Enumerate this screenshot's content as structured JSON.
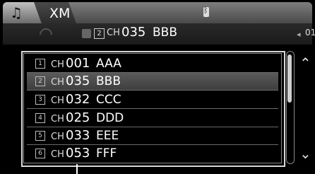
{
  "tabs": {
    "xm_label": "XM"
  },
  "now_playing": {
    "preset": "2",
    "ch_prefix": "CH",
    "channel": "035",
    "name": "BBB",
    "volume": "01"
  },
  "channels": [
    {
      "preset": "1",
      "ch_prefix": "CH",
      "number": "001",
      "name": "AAA",
      "selected": false
    },
    {
      "preset": "2",
      "ch_prefix": "CH",
      "number": "035",
      "name": "BBB",
      "selected": true
    },
    {
      "preset": "3",
      "ch_prefix": "CH",
      "number": "032",
      "name": "CCC",
      "selected": false
    },
    {
      "preset": "4",
      "ch_prefix": "CH",
      "number": "025",
      "name": "DDD",
      "selected": false
    },
    {
      "preset": "5",
      "ch_prefix": "CH",
      "number": "033",
      "name": "EEE",
      "selected": false
    },
    {
      "preset": "6",
      "ch_prefix": "CH",
      "number": "053",
      "name": "FFF",
      "selected": false
    }
  ],
  "icons": {
    "music": "music-note-icon",
    "bluetooth": "bluetooth-icon",
    "satellite": "satellite-signal-icon",
    "up": "scroll-up-icon",
    "down": "scroll-down-icon"
  }
}
